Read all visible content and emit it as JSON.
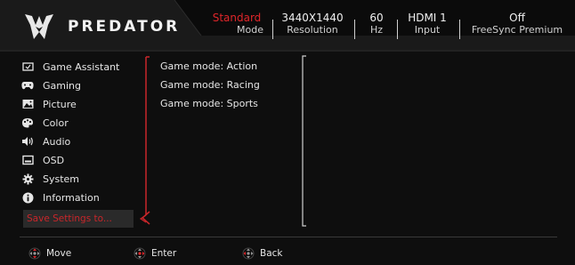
{
  "brand": {
    "name": "PREDATOR"
  },
  "status": [
    {
      "value": "Standard",
      "label": "Mode"
    },
    {
      "value": "3440X1440",
      "label": "Resolution"
    },
    {
      "value": "60",
      "label": "Hz"
    },
    {
      "value": "HDMI 1",
      "label": "Input"
    },
    {
      "value": "Off",
      "label": "FreeSync Premium"
    }
  ],
  "menu": {
    "items": [
      {
        "label": "Game Assistant",
        "icon": "game-assistant-icon"
      },
      {
        "label": "Gaming",
        "icon": "gamepad-icon"
      },
      {
        "label": "Picture",
        "icon": "picture-icon"
      },
      {
        "label": "Color",
        "icon": "palette-icon"
      },
      {
        "label": "Audio",
        "icon": "speaker-icon"
      },
      {
        "label": "OSD",
        "icon": "osd-icon"
      },
      {
        "label": "System",
        "icon": "gear-icon"
      },
      {
        "label": "Information",
        "icon": "info-icon"
      }
    ],
    "selected": {
      "label": "Save Settings to..."
    }
  },
  "submenu": {
    "items": [
      {
        "label": "Game mode: Action"
      },
      {
        "label": "Game mode: Racing"
      },
      {
        "label": "Game mode: Sports"
      }
    ]
  },
  "footer": {
    "move": "Move",
    "enter": "Enter",
    "back": "Back"
  },
  "colors": {
    "accent": "#e0262a",
    "background": "#0e0e0e",
    "selected_bg": "#2a2a2a"
  }
}
